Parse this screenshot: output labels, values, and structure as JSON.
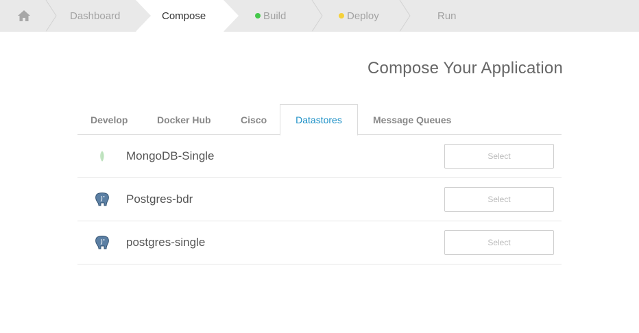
{
  "breadcrumb": {
    "home_icon": "home-icon",
    "steps": [
      {
        "label": "Dashboard",
        "status_color": null
      },
      {
        "label": "Compose",
        "status_color": null
      },
      {
        "label": "Build",
        "status_color": "#44c84a"
      },
      {
        "label": "Deploy",
        "status_color": "#f5d13b"
      },
      {
        "label": "Run",
        "status_color": null
      }
    ],
    "current": "Compose"
  },
  "page": {
    "title": "Compose Your Application"
  },
  "tabs": [
    {
      "label": "Develop"
    },
    {
      "label": "Docker Hub"
    },
    {
      "label": "Cisco"
    },
    {
      "label": "Datastores"
    },
    {
      "label": "Message Queues"
    }
  ],
  "active_tab": "Datastores",
  "datastores": [
    {
      "name": "MongoDB-Single",
      "icon": "mongodb-leaf-icon",
      "action": "Select"
    },
    {
      "name": "Postgres-bdr",
      "icon": "postgres-elephant-icon",
      "action": "Select"
    },
    {
      "name": "postgres-single",
      "icon": "postgres-elephant-icon",
      "action": "Select"
    }
  ],
  "colors": {
    "accent": "#1a8fc6",
    "build_status": "#44c84a",
    "deploy_status": "#f5d13b"
  }
}
